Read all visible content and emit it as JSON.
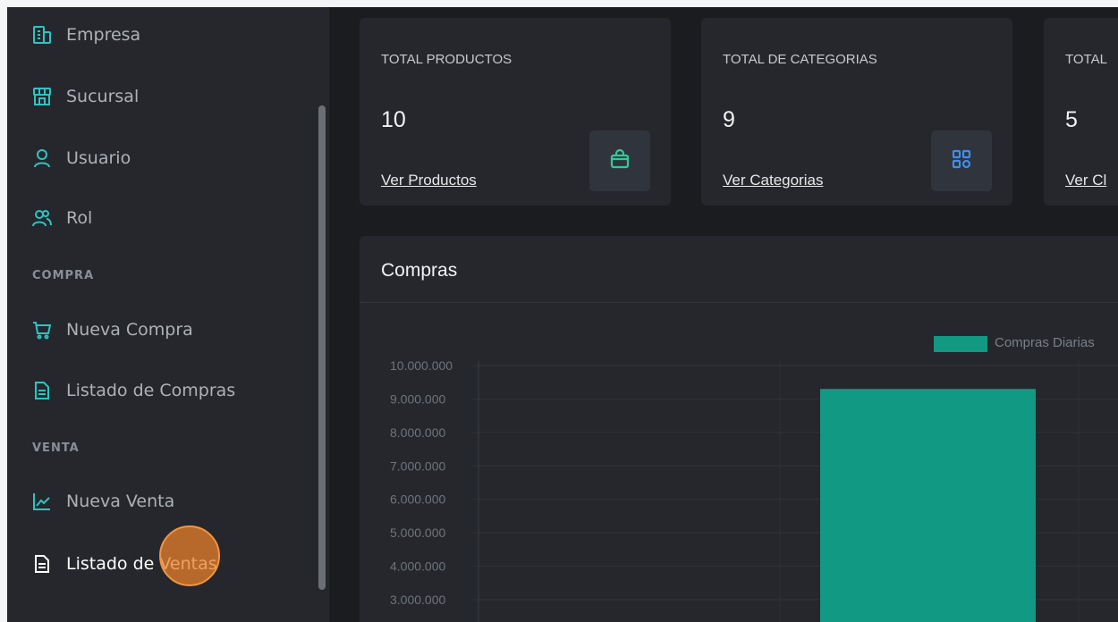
{
  "sidebar": {
    "items": [
      {
        "label": "Empresa",
        "icon": "building-icon"
      },
      {
        "label": "Sucursal",
        "icon": "store-icon"
      },
      {
        "label": "Usuario",
        "icon": "user-icon"
      },
      {
        "label": "Rol",
        "icon": "users-icon"
      }
    ],
    "sections": {
      "compra": {
        "label": "COMPRA",
        "items": [
          {
            "label": "Nueva Compra",
            "icon": "cart-icon"
          },
          {
            "label": "Listado de Compras",
            "icon": "document-icon"
          }
        ]
      },
      "venta": {
        "label": "VENTA",
        "items": [
          {
            "label": "Nueva Venta",
            "icon": "chart-line-icon"
          },
          {
            "label": "Listado de Ventas",
            "icon": "document-icon"
          }
        ]
      }
    }
  },
  "cards": [
    {
      "title": "TOTAL PRODUCTOS",
      "value": "10",
      "link": "Ver Productos",
      "icon": "bag-icon"
    },
    {
      "title": "TOTAL DE CATEGORIAS",
      "value": "9",
      "link": "Ver Categorias",
      "icon": "grid-icon"
    },
    {
      "title": "TOTAL",
      "value": "5",
      "link": "Ver Cl"
    }
  ],
  "colors": {
    "accent": "#119984",
    "sidebar_bg": "#25272c",
    "page_bg": "#1b1c20",
    "cursor_highlight": "#f3953e"
  },
  "chart_panel": {
    "title": "Compras"
  },
  "chart_data": {
    "type": "bar",
    "title": "Compras",
    "series": [
      {
        "name": "Compras Diarias",
        "values": [
          0,
          9300000
        ]
      }
    ],
    "y_tick_labels": [
      "10.000.000",
      "9.000.000",
      "8.000.000",
      "7.000.000",
      "6.000.000",
      "5.000.000",
      "4.000.000",
      "3.000.000"
    ],
    "ylim": [
      0,
      10000000
    ],
    "grid": true,
    "legend": "top-right"
  }
}
